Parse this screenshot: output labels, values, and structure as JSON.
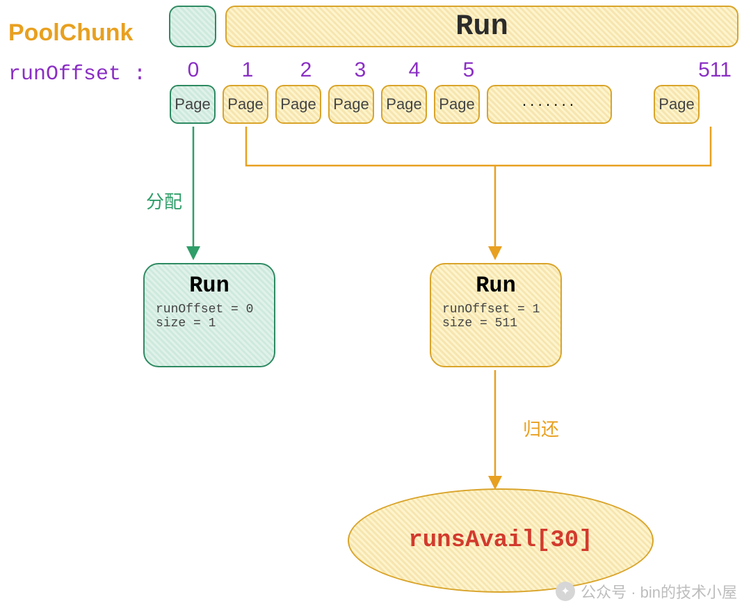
{
  "labels": {
    "poolchunk": "PoolChunk",
    "runbar": "Run",
    "runoffset_label": "runOffset :",
    "page": "Page",
    "dots": "·······",
    "allocate": "分配",
    "return": "归还",
    "runsavail": "runsAvail[30]",
    "watermark": "公众号 · bin的技术小屋"
  },
  "offsets": [
    "0",
    "1",
    "2",
    "3",
    "4",
    "5",
    "511"
  ],
  "run_left": {
    "title": "Run",
    "line1": "runOffset = 0",
    "line2": "size = 1"
  },
  "run_right": {
    "title": "Run",
    "line1": "runOffset = 1",
    "line2": "size = 511"
  },
  "colors": {
    "green": "#2f9e69",
    "orange": "#e8a020",
    "purple": "#8a2fc4",
    "red": "#d23a2d"
  }
}
